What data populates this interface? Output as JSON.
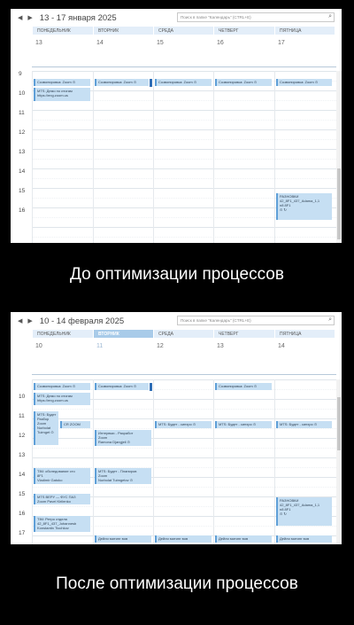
{
  "search_placeholder": "Поиск в папке \"Календарь\" (CTRL+E)",
  "nav": {
    "prev": "◀",
    "next": "▶"
  },
  "top": {
    "range": "13 - 17 января 2025",
    "days": [
      {
        "name": "ПОНЕДЕЛЬНИК",
        "num": "13"
      },
      {
        "name": "ВТОРНИК",
        "num": "14"
      },
      {
        "name": "СРЕДА",
        "num": "15"
      },
      {
        "name": "ЧЕТВЕРГ",
        "num": "16"
      },
      {
        "name": "ПЯТНИЦА",
        "num": "17"
      }
    ],
    "hours": [
      "9",
      "10",
      "11",
      "12",
      "13",
      "14",
      "15",
      "16"
    ],
    "events": [
      {
        "title": "Созвонировка: Zoom ⊙"
      },
      {
        "title": "MTS: Демо по итогам\nhttps://eng.zoom.us"
      },
      {
        "title": "Созвонировка: Zoom ⊙"
      },
      {
        "title": "Созвонировка: Zoom ⊙"
      },
      {
        "title": "Созвонировка: Zoom ⊙"
      },
      {
        "title": "Созвонировка: Zoom ⊙"
      },
      {
        "title": "РАЗНОВКИ\n42_8F1_437_Adama_1,1\nn8 8F1\n⊙ ↻"
      }
    ]
  },
  "bottom": {
    "range": "10 - 14 февраля 2025",
    "days": [
      {
        "name": "ПОНЕДЕЛЬНИК",
        "num": "10"
      },
      {
        "name": "ВТОРНИК",
        "num": "11"
      },
      {
        "name": "СРЕДА",
        "num": "12"
      },
      {
        "name": "ЧЕТВЕРГ",
        "num": "13"
      },
      {
        "name": "ПЯТНИЦА",
        "num": "14"
      }
    ],
    "hours": [
      "10",
      "11",
      "12",
      "13",
      "14",
      "15",
      "16",
      "17"
    ],
    "events": [
      {
        "title": "Созвонировка: Zoom ⊙"
      },
      {
        "title": "MTS: Демо по итогам\nhttps://eng.zoom.us"
      },
      {
        "title": "Созвонировка: Zoom ⊙"
      },
      {
        "title": "Созвонировка: Zoom ⊙"
      },
      {
        "title": "MTS: Будет\nРазбор\nZoom\nNurbolat\nTuimget ⊙"
      },
      {
        "title": "CR ZOOM"
      },
      {
        "title": "MTS: Будет - синхро ⊙"
      },
      {
        "title": "MTS: Будет - синхро ⊙"
      },
      {
        "title": "MTS: Будет - синхро ⊙"
      },
      {
        "title": "Интервью - Разработ\nZoom\nRamona Djangjeli ⊙"
      },
      {
        "title": "TIM: обследование сто\n8F1\nVladimir Gatoko"
      },
      {
        "title": "MTS: Будет - Планиров\nZoom\nNurbolat Tuimgetov ⊙"
      },
      {
        "title": "MTS ВЕРУ — ФУС ПАЗ\nZoom Pavel Kirilenko"
      },
      {
        "title": "TIM: Ретро отдела\n42_8F1_437_Johannesb\nKonstantin Tiochkov"
      },
      {
        "title": "РАЗНОВКИ\n42_8F1_437_Adama_1,1\nn8 8F1\n⊙ ↻"
      },
      {
        "title": "Дейли митинг вов"
      },
      {
        "title": "Дейли митинг вов"
      },
      {
        "title": "Дейли митинг вов"
      },
      {
        "title": "Дейли митинг вов"
      }
    ]
  },
  "captions": {
    "before": "До оптимизации процессов",
    "after": "После оптимизации процессов"
  },
  "colors": {
    "event_bg": "#c6dff3",
    "event_border": "#5f9fd7",
    "today_header": "#a8cbe9",
    "marker": "#2e6db5"
  }
}
